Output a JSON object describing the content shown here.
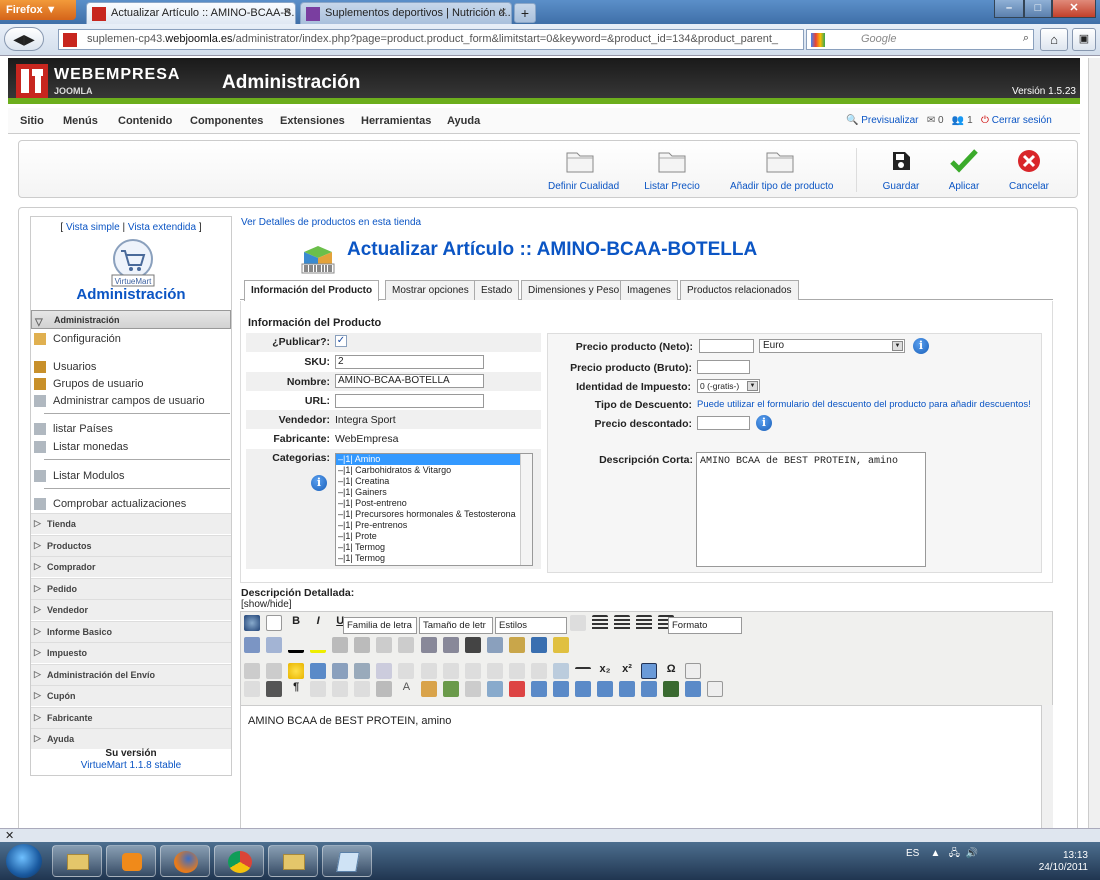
{
  "browser": {
    "app_menu": "Firefox ▼",
    "tabs": [
      {
        "title": "Actualizar Artículo :: AMINO-BCAA-B..."
      },
      {
        "title": "Suplementos deportivos | Nutrición d..."
      }
    ],
    "url_host_prefix": "suplemen-cp43.",
    "url_host_bold": "webjoomla.es",
    "url_path": "/administrator/index.php?page=product.product_form&limitstart=0&keyword=&product_id=134&product_parent_",
    "search_engine": "Google",
    "win_controls": [
      "–",
      "□",
      "✕"
    ]
  },
  "header": {
    "brand": "WEBEMPRESA",
    "brand_sub": "JOOMLA",
    "title": "Administración",
    "version": "Versión 1.5.23"
  },
  "menu": {
    "items": [
      "Sitio",
      "Menús",
      "Contenido",
      "Componentes",
      "Extensiones",
      "Herramientas",
      "Ayuda"
    ],
    "preview": "Previsualizar",
    "messages": "0",
    "users": "1",
    "logout": "Cerrar sesión"
  },
  "toolbar": {
    "buttons": [
      {
        "label": "Definir Cualidad",
        "icon": "folder-icon"
      },
      {
        "label": "Listar Precio",
        "icon": "folder-icon"
      },
      {
        "label": "Añadir tipo de producto",
        "icon": "folder-icon"
      },
      {
        "label": "Guardar",
        "icon": "save-icon"
      },
      {
        "label": "Aplicar",
        "icon": "check-icon"
      },
      {
        "label": "Cancelar",
        "icon": "cancel-icon"
      }
    ]
  },
  "sidebar": {
    "view_open": "[ ",
    "view_simple": "Vista simple",
    "view_sep": " | ",
    "view_extended": "Vista extendida",
    "view_close": " ]",
    "logo_text": "VirtueMart",
    "title": "Administración",
    "items": [
      {
        "label": "Administración"
      },
      {
        "label": "Configuración"
      },
      {
        "label": "Usuarios"
      },
      {
        "label": "Grupos de usuario"
      },
      {
        "label": "Administrar campos de usuario"
      },
      {
        "label": "listar Países"
      },
      {
        "label": "Listar monedas"
      },
      {
        "label": "Listar Modulos"
      },
      {
        "label": "Comprobar actualizaciones"
      }
    ],
    "sections": [
      "Tienda",
      "Productos",
      "Comprador",
      "Pedido",
      "Vendedor",
      "Informe Basico",
      "Impuesto",
      "Administración del Envío",
      "Cupón",
      "Fabricante",
      "Ayuda"
    ],
    "version_title": "Su versión",
    "version_value": "VirtueMart 1.1.8 stable"
  },
  "content": {
    "view_details_link": "Ver Detalles de productos en esta tienda",
    "page_title": "Actualizar Artículo :: AMINO-BCAA-BOTELLA",
    "tabs": [
      "Información del Producto",
      "Mostrar opciones",
      "Estado",
      "Dimensiones y Peso",
      "Imagenes",
      "Productos relacionados"
    ],
    "section_title": "Información del Producto",
    "fields": {
      "publish_label": "¿Publicar?:",
      "sku_label": "SKU:",
      "sku_value": "2",
      "name_label": "Nombre:",
      "name_value": "AMINO-BCAA-BOTELLA",
      "url_label": "URL:",
      "url_value": "",
      "vendor_label": "Vendedor:",
      "vendor_value": "Integra Sport",
      "manufacturer_label": "Fabricante:",
      "manufacturer_value": "WebEmpresa",
      "categories_label": "Categorias:"
    },
    "categories": [
      {
        "label": "–|1| Amino",
        "selected": true
      },
      {
        "label": "–|1| Carbohidratos & Vitargo"
      },
      {
        "label": "–|1| Creatina"
      },
      {
        "label": "–|1| Gainers"
      },
      {
        "label": "–|1| Post-entreno"
      },
      {
        "label": "–|1| Precursores hormonales & Testosterona"
      },
      {
        "label": "–|1| Pre-entrenos"
      },
      {
        "label": "–|1| Prote"
      },
      {
        "label": "–|1| Termog"
      },
      {
        "label": "–|1| Termog"
      }
    ],
    "pricing": {
      "net_label": "Precio producto (Neto):",
      "net_value": "",
      "currency": "Euro",
      "gross_label": "Precio producto (Bruto):",
      "gross_value": "",
      "tax_label": "Identidad de Impuesto:",
      "tax_value": "0 (-gratis-)",
      "discount_type_label": "Tipo de Descuento:",
      "discount_type_link": "Puede utilizar el formulario del descuento del producto para añadir descuentos!",
      "discounted_label": "Precio descontado:",
      "discounted_value": "",
      "short_desc_label": "Descripción Corta:",
      "short_desc_value": "AMINO BCAA de BEST PROTEIN, amino"
    },
    "editor": {
      "label": "Descripción Detallada:",
      "showhide": "[show/hide]",
      "font_family": "Familia de letra",
      "font_size": "Tamaño de letr",
      "styles": "Estilos",
      "format": "Formato",
      "body": "AMINO BCAA de BEST PROTEIN, amino"
    }
  },
  "taskbar": {
    "lang": "ES",
    "time": "13:13",
    "date": "24/10/2011"
  }
}
